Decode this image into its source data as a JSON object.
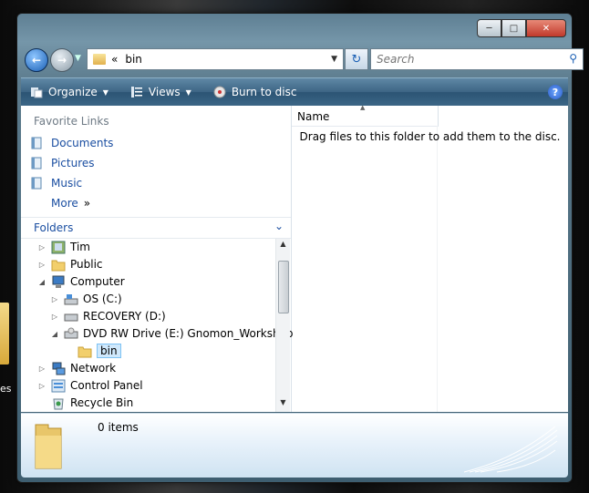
{
  "address": {
    "chevron": "«",
    "crumb": "bin"
  },
  "search": {
    "placeholder": "Search"
  },
  "toolbar": {
    "organize": "Organize",
    "views": "Views",
    "burn": "Burn to disc",
    "help": "?"
  },
  "favorites": {
    "title": "Favorite Links",
    "items": [
      {
        "label": "Documents"
      },
      {
        "label": "Pictures"
      },
      {
        "label": "Music"
      },
      {
        "label": "More",
        "suffix": "»"
      }
    ]
  },
  "folders": {
    "title": "Folders"
  },
  "tree": [
    {
      "label": "Tim"
    },
    {
      "label": "Public"
    },
    {
      "label": "Computer"
    },
    {
      "label": "OS (C:)"
    },
    {
      "label": "RECOVERY (D:)"
    },
    {
      "label": "DVD RW Drive (E:) Gnomon_Workshop"
    },
    {
      "label": "bin"
    },
    {
      "label": "Network"
    },
    {
      "label": "Control Panel"
    },
    {
      "label": "Recycle Bin"
    }
  ],
  "list": {
    "column_name": "Name",
    "empty_message": "Drag files to this folder to add them to the disc."
  },
  "details": {
    "item_count": "0 items"
  },
  "desktop": {
    "icon_text": "es"
  }
}
